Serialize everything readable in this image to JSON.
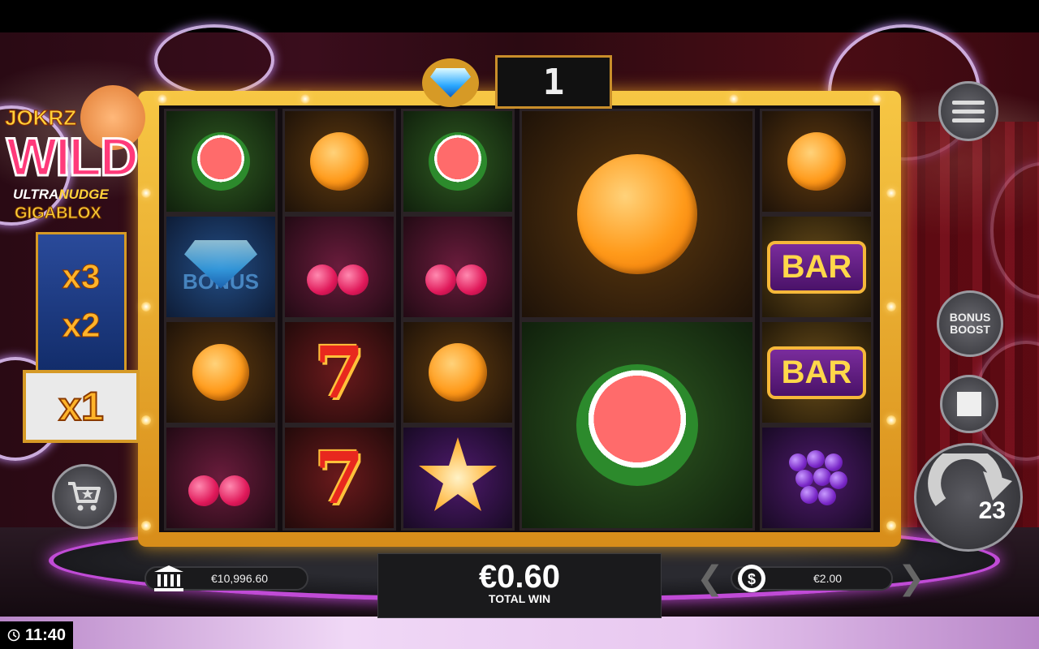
{
  "game": {
    "logo": {
      "top": "JOKRZ",
      "main": "WILD",
      "line1": "ULTRA",
      "line1b": "NUDGE",
      "line2": "GIGABLOX"
    },
    "feature_counter": "1",
    "multipliers": [
      "x3",
      "x2"
    ],
    "active_multiplier": "x1",
    "bonus_boost_label": "BONUS BOOST",
    "spin_counter": "23",
    "bonus_symbol_label": "BONUS",
    "bar_label": "BAR",
    "seven_label": "7"
  },
  "footer": {
    "balance": "€10,996.60",
    "total_win_value": "€0.60",
    "total_win_label": "TOTAL WIN",
    "bet": "€2.00",
    "clock": "11:40"
  },
  "icons": [
    "bank-icon",
    "coin-icon",
    "cart-icon",
    "menu-icon",
    "stop-icon",
    "spin-icon",
    "clock-icon",
    "diamond-icon"
  ]
}
